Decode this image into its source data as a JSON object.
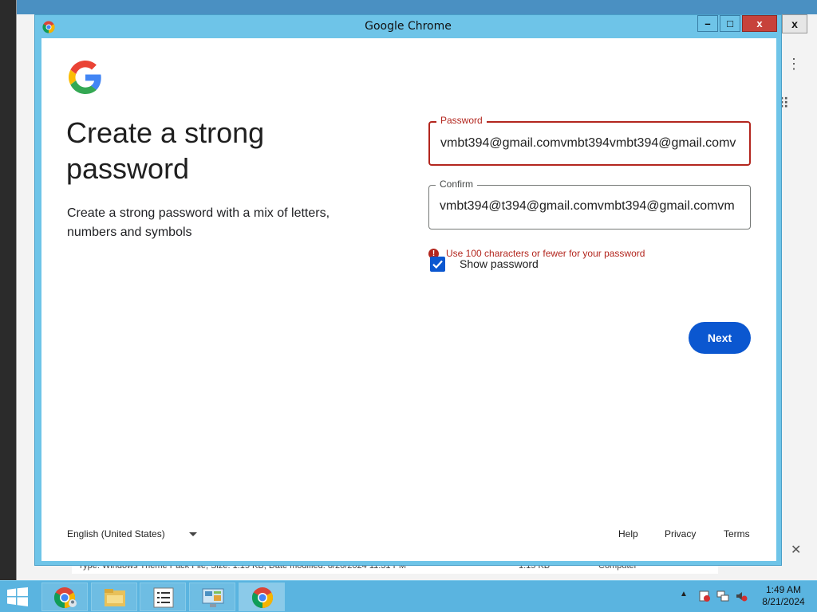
{
  "window": {
    "title": "Google Chrome",
    "minimize": "–",
    "maximize": "□",
    "close": "x"
  },
  "page": {
    "heading": "Create a strong password",
    "subtext": "Create a strong password with a mix of letters, numbers and symbols",
    "password": {
      "label": "Password",
      "value": "vmbt394@gmail.comvmbt394vmbt394@gmail.comv"
    },
    "confirm": {
      "label": "Confirm",
      "value": "vmbt394@t394@gmail.comvmbt394@gmail.comvm"
    },
    "error": "Use 100 characters or fewer for your password",
    "show_password": {
      "label": "Show password",
      "checked": true
    },
    "next": "Next",
    "footer": {
      "language": "English (United States)",
      "help": "Help",
      "privacy": "Privacy",
      "terms": "Terms"
    }
  },
  "background": {
    "outer_close": "x",
    "status_text": "Type: Windows Theme Pack File, Size: 1.15 KB, Date modified: 8/20/2024 11:31 PM",
    "status_size": "1.15 KB",
    "status_location": "Computer"
  },
  "taskbar": {
    "time": "1:49 AM",
    "date": "8/21/2024"
  },
  "colors": {
    "accent": "#0b57d0",
    "error": "#b3261e",
    "titlebar": "#6ec4e8"
  }
}
